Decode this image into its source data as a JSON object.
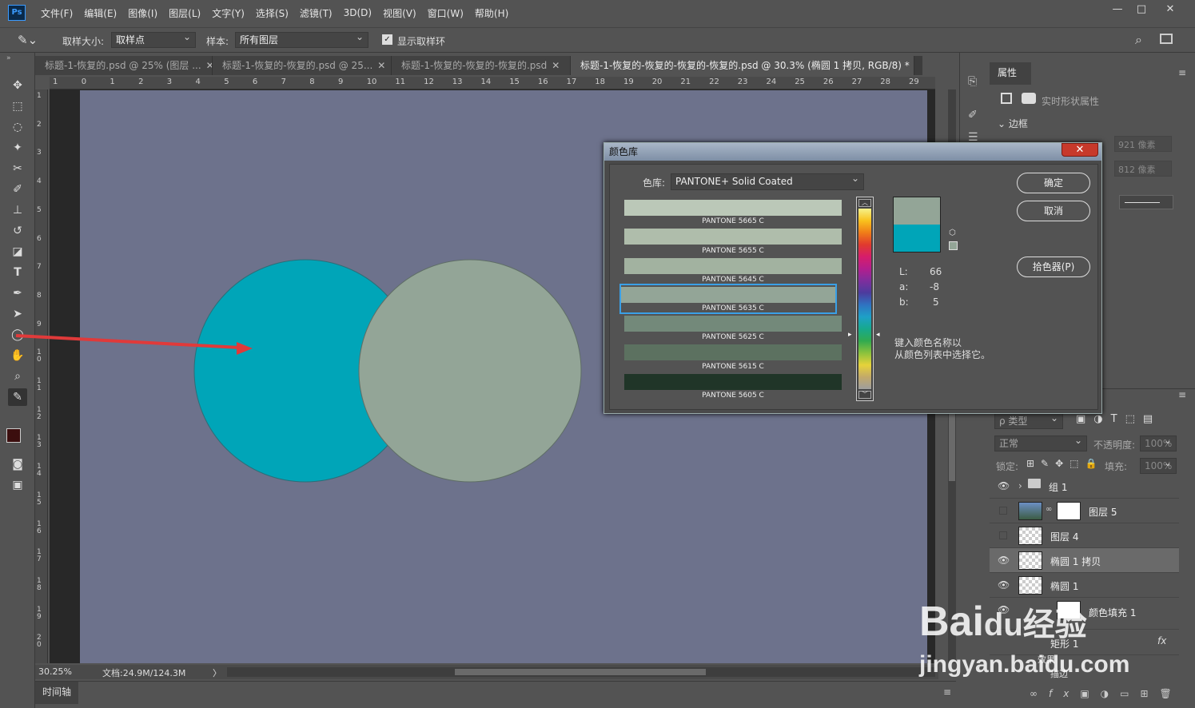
{
  "app": {
    "logo": "Ps"
  },
  "menu": [
    "文件(F)",
    "编辑(E)",
    "图像(I)",
    "图层(L)",
    "文字(Y)",
    "选择(S)",
    "滤镜(T)",
    "3D(D)",
    "视图(V)",
    "窗口(W)",
    "帮助(H)"
  ],
  "window_controls": {
    "minimize": "—",
    "maximize": "□",
    "close": "✕"
  },
  "options": {
    "sample_size_label": "取样大小:",
    "sample_size_value": "取样点",
    "sample_label": "样本:",
    "sample_value": "所有图层",
    "show_ring_label": "显示取样环",
    "show_ring_checked": true
  },
  "tabs": [
    {
      "label": "标题-1-恢复的.psd @ 25% (图层 ...",
      "close": "✕"
    },
    {
      "label": "标题-1-恢复的-恢复的.psd @ 25...",
      "close": "✕"
    },
    {
      "label": "标题-1-恢复的-恢复的-恢复的.psd",
      "close": "✕"
    },
    {
      "label": "标题-1-恢复的-恢复的-恢复的-恢复的.psd @ 30.3% (椭圆 1 拷贝, RGB/8) *",
      "close": "✕"
    }
  ],
  "ruler_h": [
    "1",
    "0",
    "1",
    "2",
    "3",
    "4",
    "5",
    "6",
    "7",
    "8",
    "9",
    "10",
    "11",
    "12",
    "13",
    "14",
    "15",
    "16",
    "17",
    "18",
    "19",
    "20",
    "21",
    "22",
    "23",
    "24",
    "25",
    "26",
    "27",
    "28",
    "29",
    "3"
  ],
  "ruler_v": [
    "1",
    "2",
    "3",
    "4",
    "5",
    "6",
    "7",
    "8",
    "9",
    "1 0",
    "1 1",
    "1 2",
    "1 3",
    "1 4",
    "1 5",
    "1 6",
    "1 7",
    "1 8",
    "1 9",
    "2 0"
  ],
  "status": {
    "zoom": "30.25%",
    "doc": "文档:24.9M/124.3M",
    "arrow": "〉"
  },
  "timeline": {
    "label": "时间轴"
  },
  "colors": {
    "canvas": "#6d728c",
    "circle_teal": "#00a5b8",
    "circle_gray": "#93a597",
    "arrow": "#e03a3a",
    "pantone_5665": "#bbc8b8",
    "pantone_5655": "#afbdab",
    "pantone_5645": "#a2b2a0",
    "pantone_5635": "#93a597",
    "pantone_5625": "#73897a",
    "pantone_5615": "#5c7160",
    "pantone_5605": "#203528"
  },
  "properties": {
    "tab": "属性",
    "subtitle": "实时形状属性",
    "section": "边框",
    "w": "921 像素",
    "h": "812 像素"
  },
  "layers_panel": {
    "filter": "ρ 类型",
    "blend": "正常",
    "opacity_label": "不透明度:",
    "opacity": "100%",
    "lock_label": "锁定:",
    "fill_label": "填充:",
    "fill": "100%",
    "items": [
      {
        "name": "组 1",
        "visible": true
      },
      {
        "name": "图层 5",
        "visible": false
      },
      {
        "name": "图层 4",
        "visible": false
      },
      {
        "name": "椭圆 1 拷贝",
        "visible": true
      },
      {
        "name": "椭圆 1",
        "visible": true
      },
      {
        "name": "颜色填充 1",
        "visible": true
      },
      {
        "name": "矩形 1",
        "visible": true
      }
    ],
    "effects": "效果",
    "stroke": "描边",
    "fx": "fx"
  },
  "dialog": {
    "title": "颜色库",
    "close": "✕",
    "library_label": "色库:",
    "library_value": "PANTONE+ Solid Coated",
    "ok": "确定",
    "cancel": "取消",
    "picker": "拾色器(P)",
    "L_label": "L:",
    "L": "66",
    "a_label": "a:",
    "a": "-8",
    "b_label": "b:",
    "b": "5",
    "hint_line1": "键入颜色名称以",
    "hint_line2": "从颜色列表中选择它。",
    "swatches": [
      "PANTONE 5665 C",
      "PANTONE 5655 C",
      "PANTONE 5645 C",
      "PANTONE 5635 C",
      "PANTONE 5625 C",
      "PANTONE 5615 C",
      "PANTONE 5605 C"
    ],
    "new_color": "#93a597",
    "old_color": "#00a5b8"
  },
  "watermark": {
    "brand": "Bai",
    "paw": "du",
    "cn": "经验",
    "url": "jingyan.baidu.com"
  }
}
